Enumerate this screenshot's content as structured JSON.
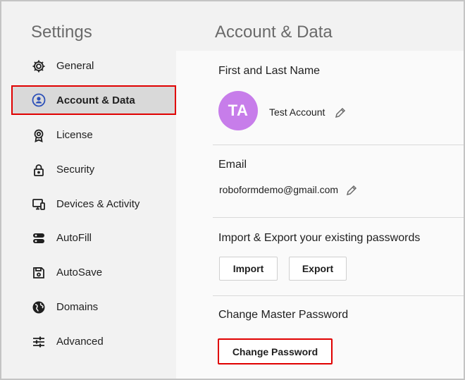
{
  "sidebar": {
    "title": "Settings",
    "items": [
      {
        "label": "General",
        "icon": "gear-icon"
      },
      {
        "label": "Account & Data",
        "icon": "account-icon",
        "active": true
      },
      {
        "label": "License",
        "icon": "license-badge-icon"
      },
      {
        "label": "Security",
        "icon": "lock-icon"
      },
      {
        "label": "Devices & Activity",
        "icon": "devices-icon"
      },
      {
        "label": "AutoFill",
        "icon": "autofill-icon"
      },
      {
        "label": "AutoSave",
        "icon": "save-icon"
      },
      {
        "label": "Domains",
        "icon": "globe-icon"
      },
      {
        "label": "Advanced",
        "icon": "sliders-icon"
      }
    ]
  },
  "page": {
    "title": "Account & Data"
  },
  "name_section": {
    "heading": "First and Last Name",
    "avatar_initials": "TA",
    "avatar_color": "#c77dea",
    "value": "Test Account"
  },
  "email_section": {
    "heading": "Email",
    "value": "roboformdemo@gmail.com"
  },
  "import_export_section": {
    "heading": "Import & Export your existing passwords",
    "import_label": "Import",
    "export_label": "Export"
  },
  "password_section": {
    "heading": "Change Master Password",
    "button_label": "Change Password"
  },
  "colors": {
    "highlight": "#e00000",
    "sidebar_bg": "#f2f2f2",
    "active_bg": "#d9d9d9"
  }
}
